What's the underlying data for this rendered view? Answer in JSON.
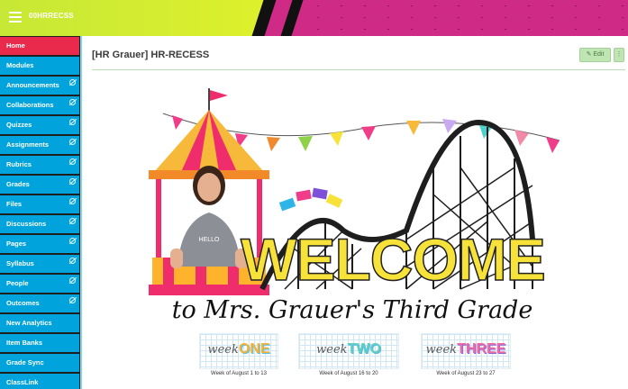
{
  "header": {
    "course_code": "00HRRECSS",
    "menu_icon": "hamburger-icon",
    "colors": {
      "lime": "#d9ef2e",
      "magenta": "#cf2a86",
      "black": "#111111"
    }
  },
  "sidebar": {
    "items": [
      {
        "label": "Home",
        "active": true,
        "hidden_icon": false
      },
      {
        "label": "Modules",
        "active": false,
        "hidden_icon": false
      },
      {
        "label": "Announcements",
        "active": false,
        "hidden_icon": true
      },
      {
        "label": "Collaborations",
        "active": false,
        "hidden_icon": true
      },
      {
        "label": "Quizzes",
        "active": false,
        "hidden_icon": true
      },
      {
        "label": "Assignments",
        "active": false,
        "hidden_icon": true
      },
      {
        "label": "Rubrics",
        "active": false,
        "hidden_icon": true
      },
      {
        "label": "Grades",
        "active": false,
        "hidden_icon": true
      },
      {
        "label": "Files",
        "active": false,
        "hidden_icon": true
      },
      {
        "label": "Discussions",
        "active": false,
        "hidden_icon": true
      },
      {
        "label": "Pages",
        "active": false,
        "hidden_icon": true
      },
      {
        "label": "Syllabus",
        "active": false,
        "hidden_icon": true
      },
      {
        "label": "People",
        "active": false,
        "hidden_icon": true
      },
      {
        "label": "Outcomes",
        "active": false,
        "hidden_icon": true
      },
      {
        "label": "New Analytics",
        "active": false,
        "hidden_icon": false
      },
      {
        "label": "Item Banks",
        "active": false,
        "hidden_icon": false
      },
      {
        "label": "Grade Sync",
        "active": false,
        "hidden_icon": false
      },
      {
        "label": "ClassLink",
        "active": false,
        "hidden_icon": false
      }
    ],
    "colors": {
      "item": "#00a3dc",
      "active": "#ea2a4c"
    }
  },
  "main": {
    "page_title": "[HR Grauer] HR-RECESS",
    "edit_label": "✎ Edit",
    "more_label": "⋮",
    "banner": {
      "welcome": "WELCOME",
      "subtitle": "to Mrs. Grauer's Third Grade",
      "shirt_text": "HELLO"
    },
    "weeks": [
      {
        "prefix": "week",
        "number": "ONE",
        "dates": "Week of August 1 to 13"
      },
      {
        "prefix": "week",
        "number": "TWO",
        "dates": "Week of August 16 to 20"
      },
      {
        "prefix": "week",
        "number": "THREE",
        "dates": "Week of August 23 to 27"
      }
    ]
  }
}
